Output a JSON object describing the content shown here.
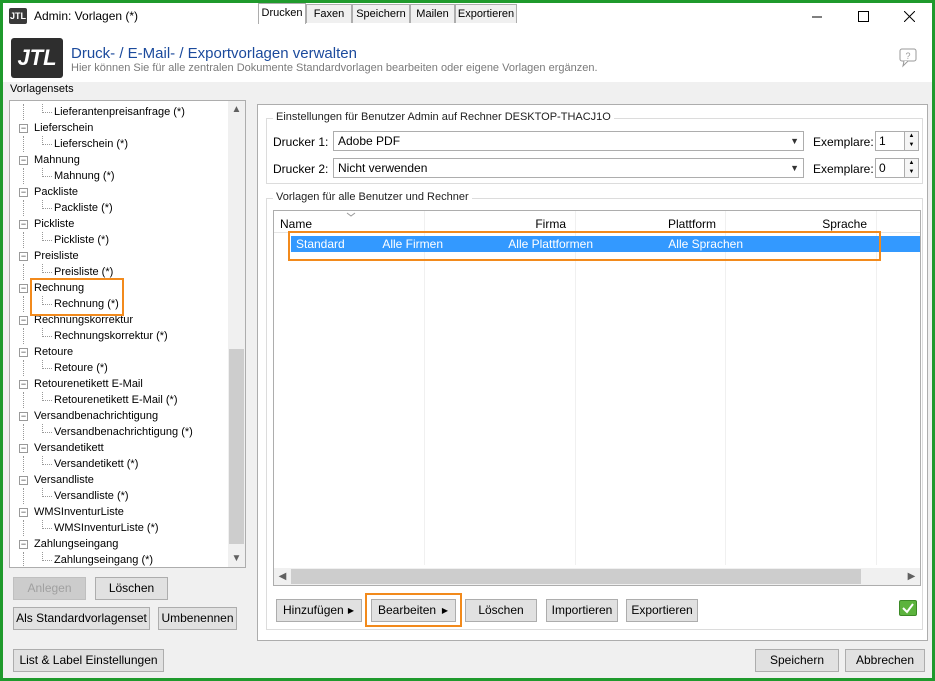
{
  "window": {
    "app_icon": "JTL",
    "title": "Admin: Vorlagen (*)"
  },
  "header": {
    "logo": "JTL",
    "title": "Druck- / E-Mail- / Exportvorlagen verwalten",
    "subtitle": "Hier können Sie für alle zentralen Dokumente Standardvorlagen bearbeiten oder eigene Vorlagen ergänzen."
  },
  "sidebar": {
    "label": "Vorlagensets",
    "tree": [
      {
        "type": "child",
        "label": "Lieferantenpreisanfrage (*)"
      },
      {
        "type": "parent",
        "label": "Lieferschein"
      },
      {
        "type": "child",
        "label": "Lieferschein (*)"
      },
      {
        "type": "parent",
        "label": "Mahnung"
      },
      {
        "type": "child",
        "label": "Mahnung (*)"
      },
      {
        "type": "parent",
        "label": "Packliste"
      },
      {
        "type": "child",
        "label": "Packliste (*)"
      },
      {
        "type": "parent",
        "label": "Pickliste"
      },
      {
        "type": "child",
        "label": "Pickliste (*)"
      },
      {
        "type": "parent",
        "label": "Preisliste"
      },
      {
        "type": "child",
        "label": "Preisliste (*)"
      },
      {
        "type": "parent",
        "label": "Rechnung"
      },
      {
        "type": "child",
        "label": "Rechnung (*)"
      },
      {
        "type": "parent",
        "label": "Rechnungskorrektur"
      },
      {
        "type": "child",
        "label": "Rechnungskorrektur (*)"
      },
      {
        "type": "parent",
        "label": "Retoure"
      },
      {
        "type": "child",
        "label": "Retoure (*)"
      },
      {
        "type": "parent",
        "label": "Retourenetikett E-Mail"
      },
      {
        "type": "child",
        "label": "Retourenetikett E-Mail (*)"
      },
      {
        "type": "parent",
        "label": "Versandbenachrichtigung"
      },
      {
        "type": "child",
        "label": "Versandbenachrichtigung (*)"
      },
      {
        "type": "parent",
        "label": "Versandetikett"
      },
      {
        "type": "child",
        "label": "Versandetikett (*)"
      },
      {
        "type": "parent",
        "label": "Versandliste"
      },
      {
        "type": "child",
        "label": "Versandliste (*)"
      },
      {
        "type": "parent",
        "label": "WMSInventurListe"
      },
      {
        "type": "child",
        "label": "WMSInventurListe (*)"
      },
      {
        "type": "parent",
        "label": "Zahlungseingang"
      },
      {
        "type": "child",
        "label": "Zahlungseingang (*)"
      }
    ],
    "buttons": {
      "anlegen": "Anlegen",
      "loeschen": "Löschen",
      "standard": "Als Standardvorlagenset",
      "umbenennen": "Umbenennen"
    }
  },
  "tabs": [
    "Drucken",
    "Faxen",
    "Speichern",
    "Mailen",
    "Exportieren"
  ],
  "printer_settings": {
    "group_title": "Einstellungen für Benutzer Admin auf Rechner DESKTOP-THACJ1O",
    "printer1_label": "Drucker 1:",
    "printer1_value": "Adobe PDF",
    "printer2_label": "Drucker 2:",
    "printer2_value": "Nicht verwenden",
    "copies_label": "Exemplare:",
    "copies1": "1",
    "copies2": "0"
  },
  "templates": {
    "group_title": "Vorlagen für alle Benutzer und Rechner",
    "columns": [
      "Name",
      "Firma",
      "Plattform",
      "Sprache"
    ],
    "rows": [
      {
        "name": "Standard",
        "firma": "Alle Firmen",
        "plattform": "Alle Plattformen",
        "sprache": "Alle Sprachen"
      }
    ]
  },
  "actions": {
    "hinzufuegen": "Hinzufügen",
    "bearbeiten": "Bearbeiten",
    "loeschen": "Löschen",
    "importieren": "Importieren",
    "exportieren": "Exportieren"
  },
  "footer": {
    "list_label": "List & Label Einstellungen",
    "save": "Speichern",
    "cancel": "Abbrechen"
  },
  "colors": {
    "highlight": "#f28a1c",
    "selection": "#3399ff",
    "title_blue": "#1b4a9c",
    "frame": "#1f9a2c"
  }
}
